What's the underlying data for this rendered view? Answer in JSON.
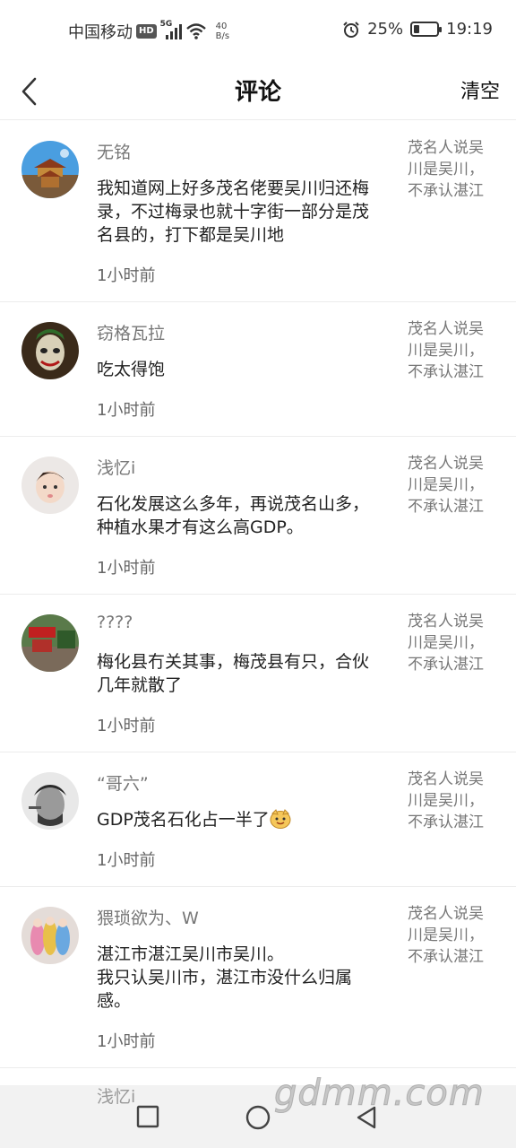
{
  "status_bar": {
    "carrier": "中国移动",
    "hd": "HD",
    "network": "5G",
    "speed_value": "40",
    "speed_unit": "B/s",
    "battery": "25%",
    "battery_level": 0.25,
    "time": "19:19"
  },
  "nav": {
    "title": "评论",
    "action": "清空"
  },
  "comments": [
    {
      "user": "无铭",
      "text": "我知道网上好多茂名佬要吴川归还梅录，不过梅录也就十字街一部分是茂名县的，打下都是吴川地",
      "time": "1小时前",
      "quote": "茂名人说吴川是吴川，不承认湛江"
    },
    {
      "user": "窃格瓦拉",
      "text": "吃太得饱",
      "time": "1小时前",
      "quote": "茂名人说吴川是吴川，不承认湛江"
    },
    {
      "user": "浅忆i",
      "text": "石化发展这么多年，再说茂名山多，种植水果才有这么高GDP。",
      "time": "1小时前",
      "quote": "茂名人说吴川是吴川，不承认湛江"
    },
    {
      "user": "????",
      "text": "梅化县冇关其事，梅茂县有只，合伙几年就散了",
      "time": "1小时前",
      "quote": "茂名人说吴川是吴川，不承认湛江"
    },
    {
      "user": "“哥六”",
      "text": "GDP茂名石化占一半了",
      "time": "1小时前",
      "quote": "茂名人说吴川是吴川，不承认湛江"
    },
    {
      "user": "猥琐欲为、W",
      "text": "湛江市湛江吴川市吴川。\n我只认吴川市，湛江市没什么归属感。",
      "time": "1小时前",
      "quote": "茂名人说吴川是吴川，不承认湛江"
    }
  ],
  "peek_user": "浅忆i",
  "watermark": "gdmm.com"
}
